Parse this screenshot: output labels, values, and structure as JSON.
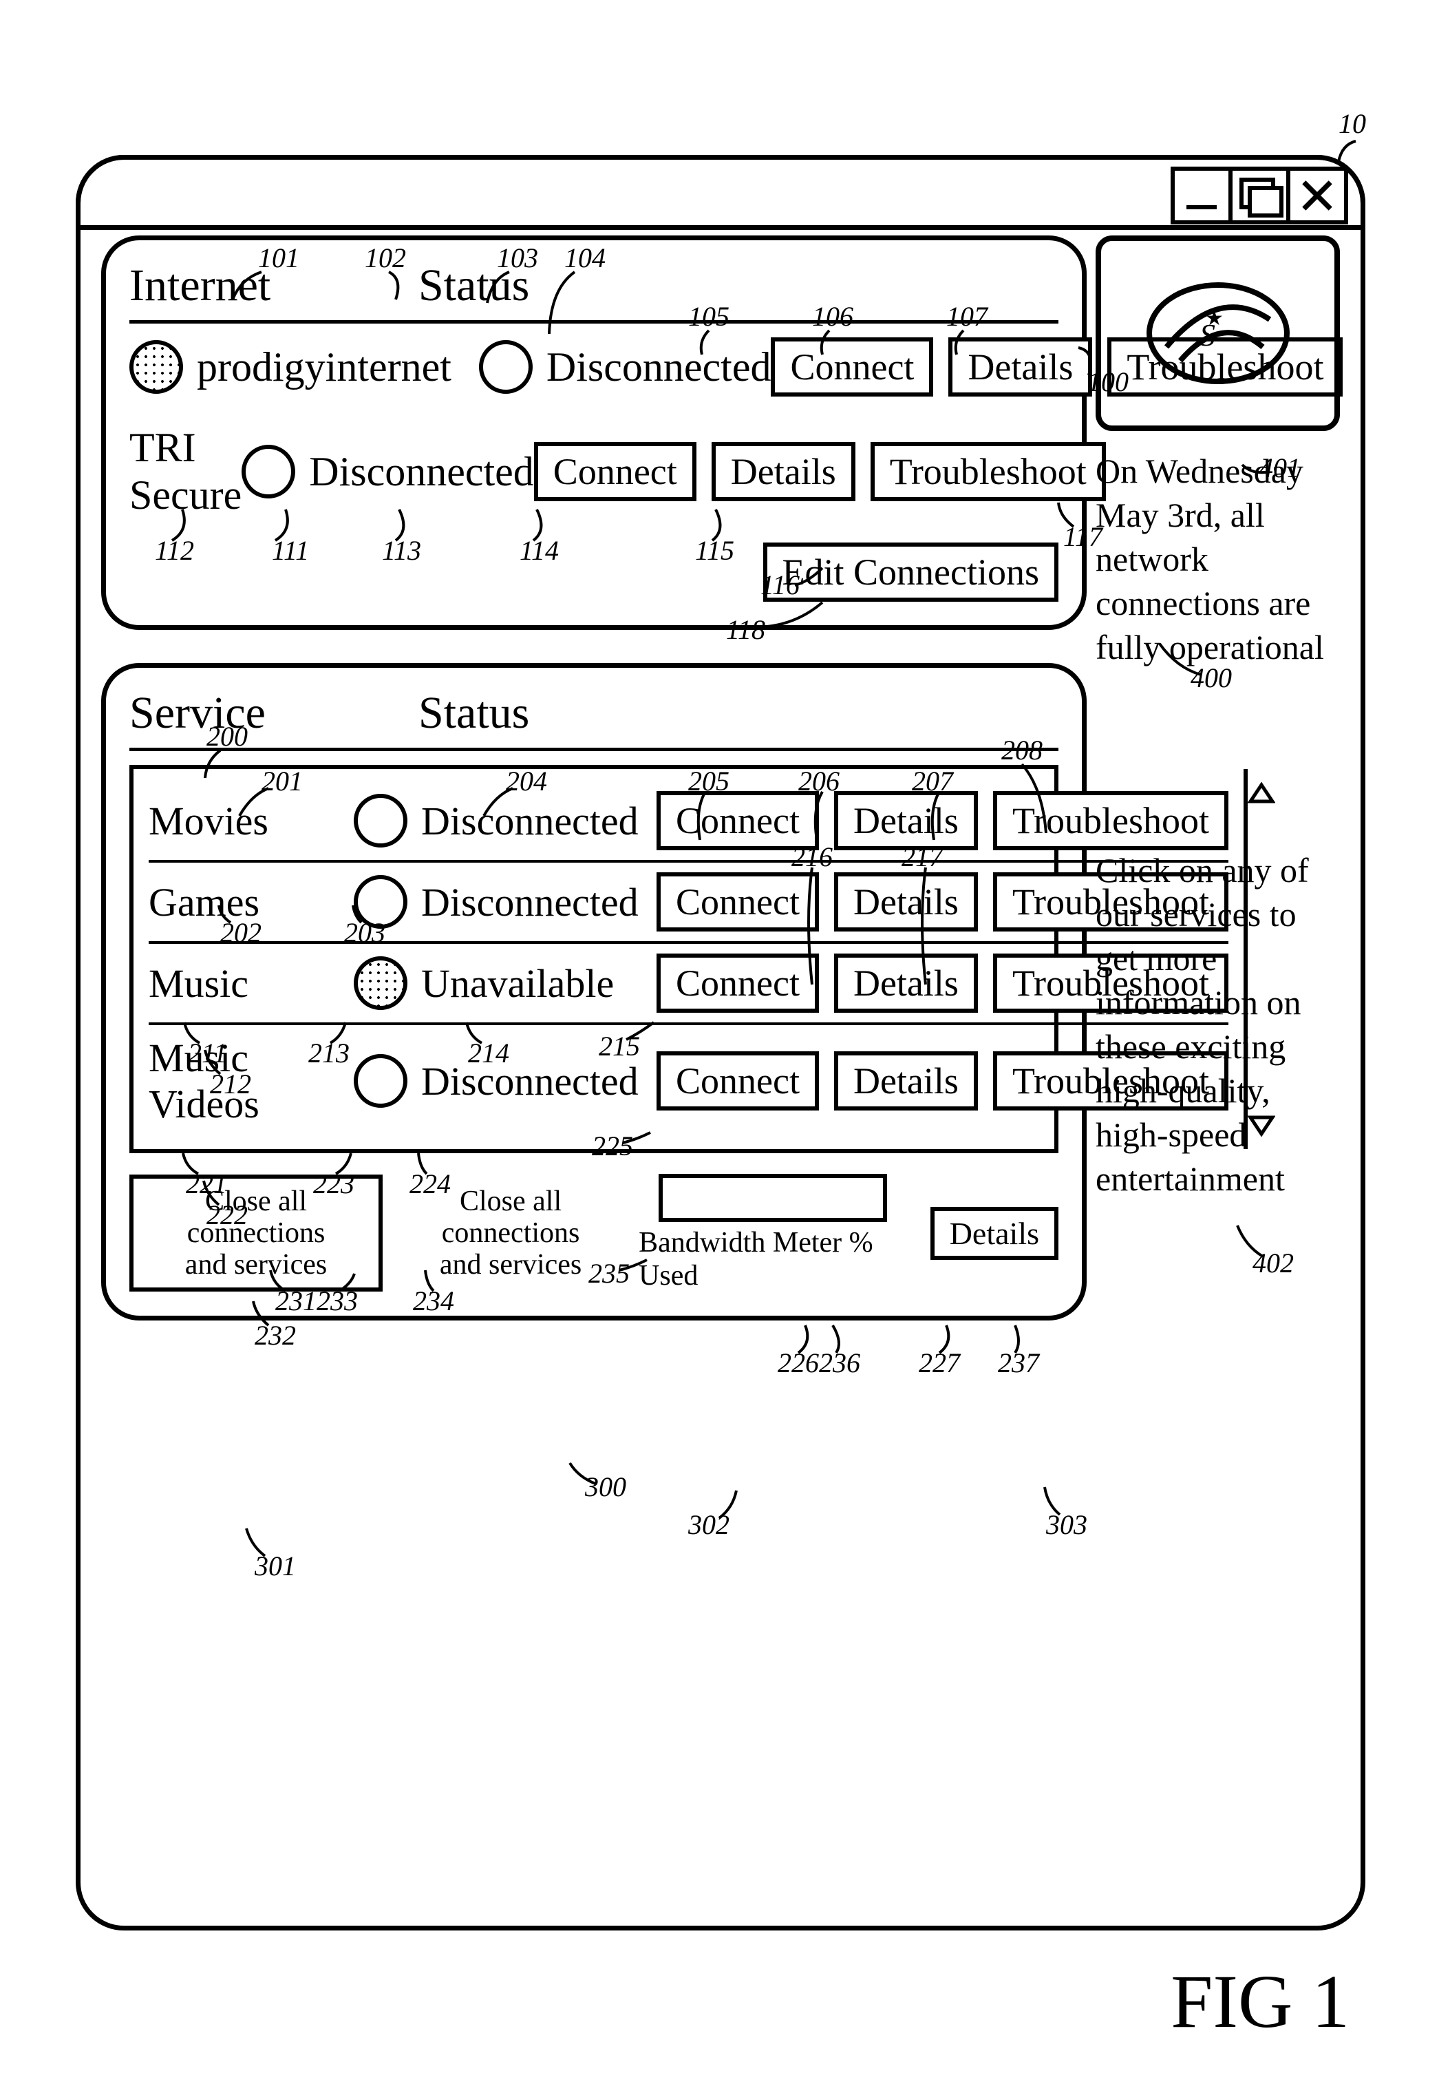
{
  "figure_label": "FIG 1",
  "panel_internet": {
    "heading_left": "Internet",
    "heading_right": "Status",
    "rows": [
      {
        "name": "prodigyinternet",
        "status": "Disconnected",
        "icon": "dotted",
        "connect": "Connect",
        "details": "Details",
        "troubleshoot": "Troubleshoot"
      },
      {
        "name": "TRI Secure",
        "status": "Disconnected",
        "icon": "open",
        "connect": "Connect",
        "details": "Details",
        "troubleshoot": "Troubleshoot"
      }
    ],
    "edit_connections": "Edit Connections"
  },
  "panel_services": {
    "heading_left": "Service",
    "heading_right": "Status",
    "rows": [
      {
        "name": "Movies",
        "status": "Disconnected",
        "icon": "open",
        "connect": "Connect",
        "details": "Details",
        "troubleshoot": "Troubleshoot"
      },
      {
        "name": "Games",
        "status": "Disconnected",
        "icon": "open",
        "connect": "Connect",
        "details": "Details",
        "troubleshoot": "Troubleshoot"
      },
      {
        "name": "Music",
        "status": "Unavailable",
        "icon": "dotted",
        "connect": "Connect",
        "details": "Details",
        "troubleshoot": "Troubleshoot"
      },
      {
        "name": "Music Videos",
        "status": "Disconnected",
        "icon": "open",
        "connect": "Connect",
        "details": "Details",
        "troubleshoot": "Troubleshoot"
      }
    ]
  },
  "footer": {
    "close_btn": "Close all connections\nand services",
    "close_label": "Close all connections\nand services",
    "meter_label": "Bandwidth Meter % Used",
    "details": "Details"
  },
  "sidebar": {
    "msg1": "On Wednesday May 3rd, all network connections are fully operational",
    "msg2": "Click on any of our services to get more information on these exciting high-quality, high-speed entertainment"
  },
  "refs": {
    "r10": "10",
    "r100": "100",
    "r101": "101",
    "r102": "102",
    "r103": "103",
    "r104": "104",
    "r105": "105",
    "r106": "106",
    "r107": "107",
    "r111": "111",
    "r112": "112",
    "r113": "113",
    "r114": "114",
    "r115": "115",
    "r116": "116",
    "r117": "117",
    "r118": "118",
    "r200": "200",
    "r201": "201",
    "r202": "202",
    "r203": "203",
    "r204": "204",
    "r205": "205",
    "r206": "206",
    "r207": "207",
    "r208": "208",
    "r211": "211",
    "r212": "212",
    "r213": "213",
    "r214": "214",
    "r215": "215",
    "r216": "216",
    "r217": "217",
    "r221": "221",
    "r222": "222",
    "r223": "223",
    "r224": "224",
    "r225": "225",
    "r226": "226",
    "r227": "227",
    "r231": "231",
    "r232": "232",
    "r233": "233",
    "r234": "234",
    "r235": "235",
    "r236": "236",
    "r237": "237",
    "r300": "300",
    "r301": "301",
    "r302": "302",
    "r303": "303",
    "r400": "400",
    "r401": "401",
    "r402": "402"
  }
}
